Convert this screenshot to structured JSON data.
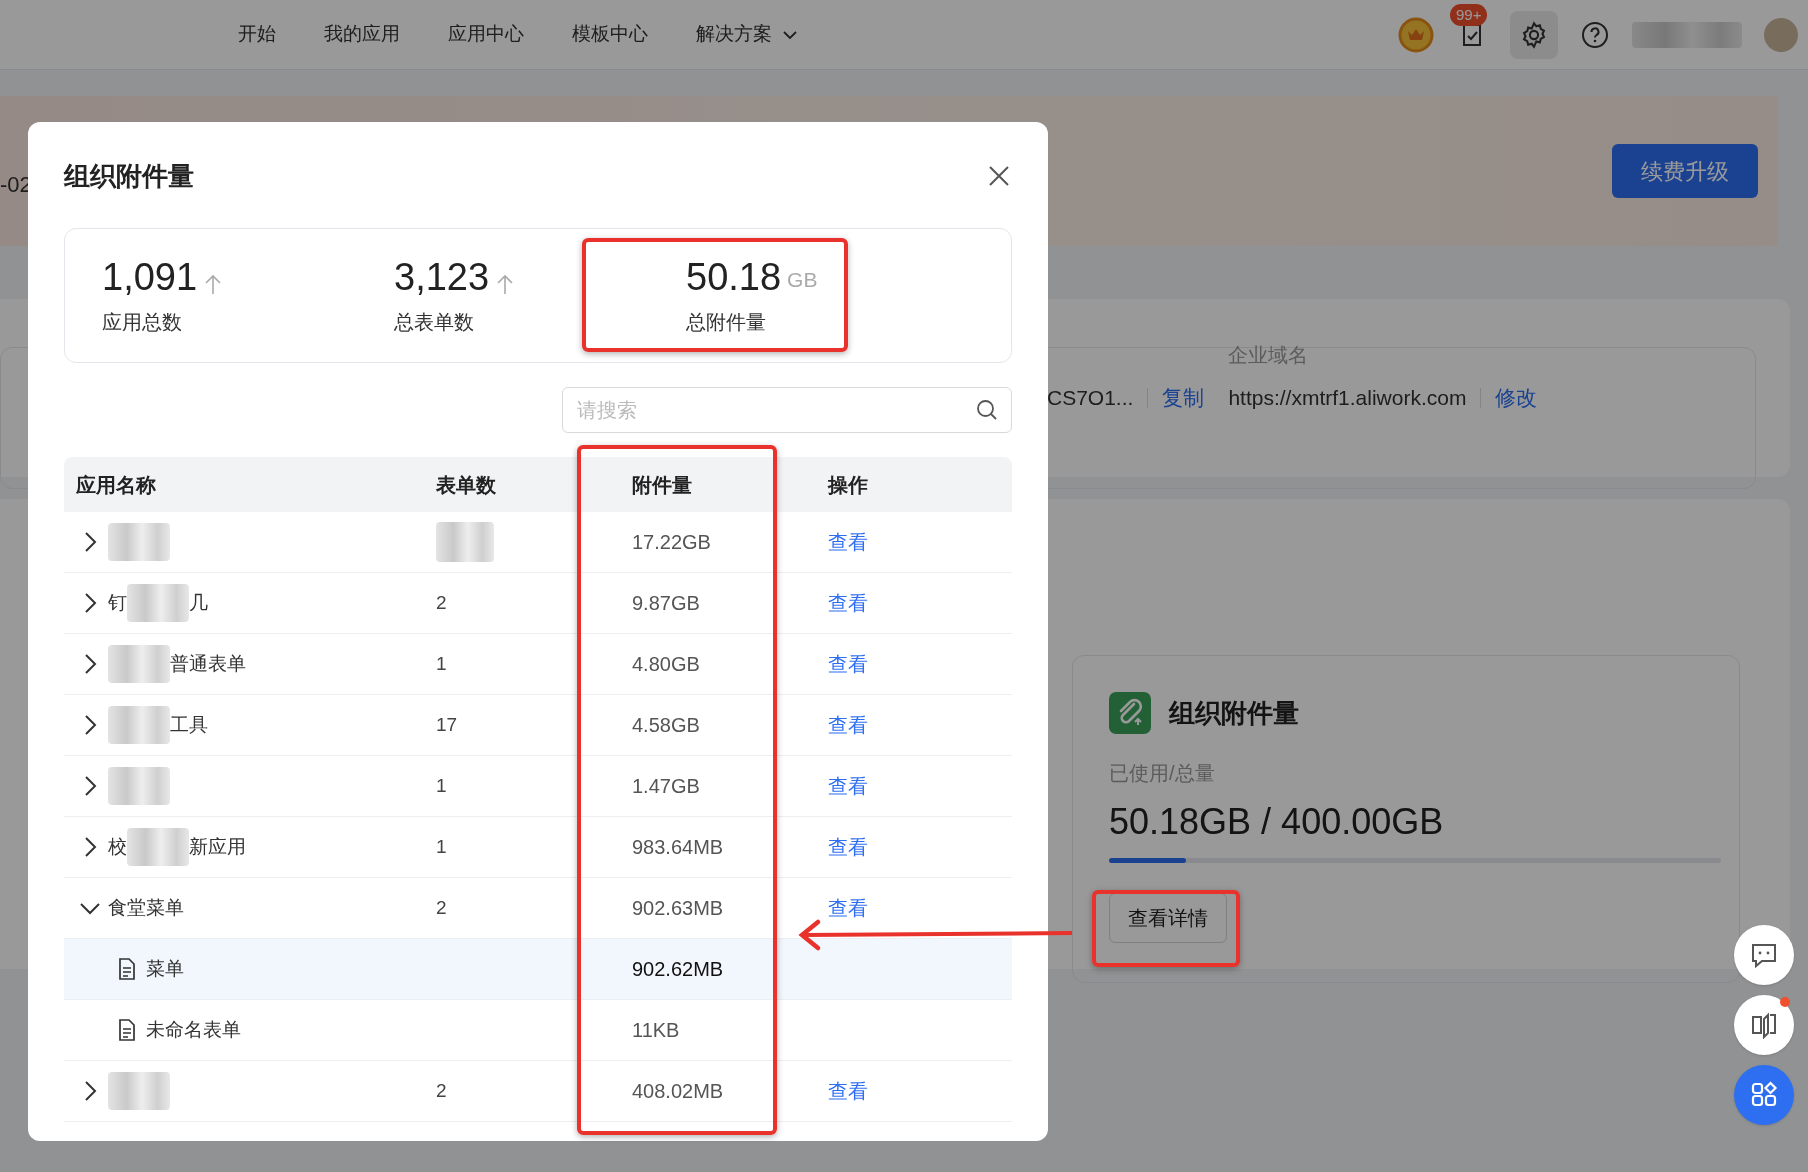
{
  "nav": {
    "items": [
      {
        "label": "开始",
        "dropdown": false
      },
      {
        "label": "我的应用",
        "dropdown": false
      },
      {
        "label": "应用中心",
        "dropdown": false
      },
      {
        "label": "模板中心",
        "dropdown": false
      },
      {
        "label": "解决方案",
        "dropdown": true
      }
    ],
    "badge": "99+"
  },
  "background": {
    "date_fragment": "-02",
    "renew_button": "续费升级",
    "info": {
      "value": "CS7O1...",
      "copy_link": "复制",
      "domain_label": "企业域名",
      "domain": "https://xmtrf1.aliwork.com",
      "edit_link": "修改"
    },
    "usage_card": {
      "title": "组织附件量",
      "label": "已使用/总量",
      "reading": "50.18GB / 400.00GB",
      "level": 0.125,
      "button": "查看详情"
    }
  },
  "modal": {
    "title": "组织附件量",
    "stats": [
      {
        "value": "1,091",
        "rising": true,
        "label": "应用总数"
      },
      {
        "value": "3,123",
        "rising": true,
        "label": "总表单数"
      },
      {
        "value": "50.18",
        "unit": "GB",
        "label": "总附件量"
      }
    ],
    "search": {
      "placeholder": "请搜索"
    },
    "table": {
      "columns": [
        "应用名称",
        "表单数",
        "附件量",
        "操作"
      ],
      "rows": [
        {
          "name": [
            {
              "kind": "redacted"
            }
          ],
          "count_redacted": true,
          "size": "17.22GB",
          "action": "查看",
          "expanded": false,
          "selected": false
        },
        {
          "name": [
            {
              "kind": "text",
              "text": "钉"
            },
            {
              "kind": "redacted"
            },
            {
              "kind": "text",
              "text": "几"
            }
          ],
          "count": "2",
          "size": "9.87GB",
          "action": "查看",
          "expanded": false,
          "selected": false
        },
        {
          "name": [
            {
              "kind": "redacted"
            },
            {
              "kind": "text",
              "text": "普通表单"
            }
          ],
          "count": "1",
          "size": "4.80GB",
          "action": "查看",
          "expanded": false,
          "selected": false
        },
        {
          "name": [
            {
              "kind": "redacted"
            },
            {
              "kind": "text",
              "text": "工具"
            }
          ],
          "count": "17",
          "size": "4.58GB",
          "action": "查看",
          "expanded": false,
          "selected": false
        },
        {
          "name": [
            {
              "kind": "redacted"
            }
          ],
          "count": "1",
          "size": "1.47GB",
          "action": "查看",
          "expanded": false,
          "selected": false
        },
        {
          "name": [
            {
              "kind": "text",
              "text": "校"
            },
            {
              "kind": "redacted"
            },
            {
              "kind": "text",
              "text": "新应用"
            }
          ],
          "count": "1",
          "size": "983.64MB",
          "action": "查看",
          "expanded": false,
          "selected": false
        },
        {
          "name": [
            {
              "kind": "text",
              "text": "食堂菜单"
            }
          ],
          "count": "2",
          "size": "902.63MB",
          "action": "查看",
          "expanded": true,
          "selected": false,
          "children": [
            {
              "name": [
                {
                  "kind": "text",
                  "text": "菜单"
                }
              ],
              "size": "902.62MB",
              "selected": true
            },
            {
              "name": [
                {
                  "kind": "text",
                  "text": "未命名表单"
                }
              ],
              "size": "11KB",
              "selected": false
            }
          ]
        },
        {
          "name": [
            {
              "kind": "redacted"
            }
          ],
          "count": "2",
          "size": "408.02MB",
          "action": "查看",
          "expanded": false,
          "selected": false
        }
      ]
    }
  }
}
